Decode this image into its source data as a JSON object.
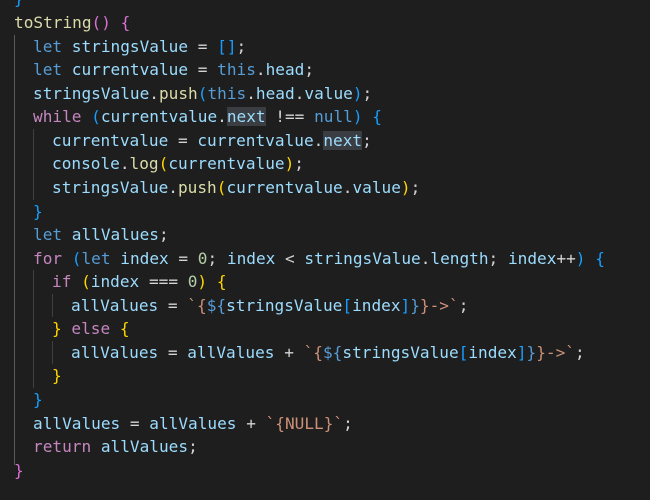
{
  "code": {
    "lines": [
      "}",
      "toString() {",
      "let stringsValue = [];",
      "let currentvalue = this.head;",
      "stringsValue.push(this.head.value);",
      "while (currentvalue.next !== null) {",
      "currentvalue = currentvalue.next;",
      "console.log(currentvalue);",
      "stringsValue.push(currentvalue.value);",
      "}",
      "let allValues;",
      "for (let index = 0; index < stringsValue.length; index++) {",
      "if (index === 0) {",
      "allValues = `{${stringsValue[index]}}->`;",
      "} else {",
      "allValues = allValues + `{${stringsValue[index]}}->`;",
      "}",
      "}",
      "allValues = allValues + `{NULL}`;",
      "return allValues;",
      "}"
    ]
  },
  "colors": {
    "background": "#1e1e1e",
    "keyword": "#569cd6",
    "control": "#c586c0",
    "variable": "#9cdcfe",
    "function": "#dcdcaa",
    "number": "#b5cea8",
    "string": "#ce9178",
    "bracket_gold": "#ffd700",
    "bracket_orchid": "#da70d6",
    "bracket_blue": "#179fff",
    "selection_highlight": "#3a3d41"
  }
}
